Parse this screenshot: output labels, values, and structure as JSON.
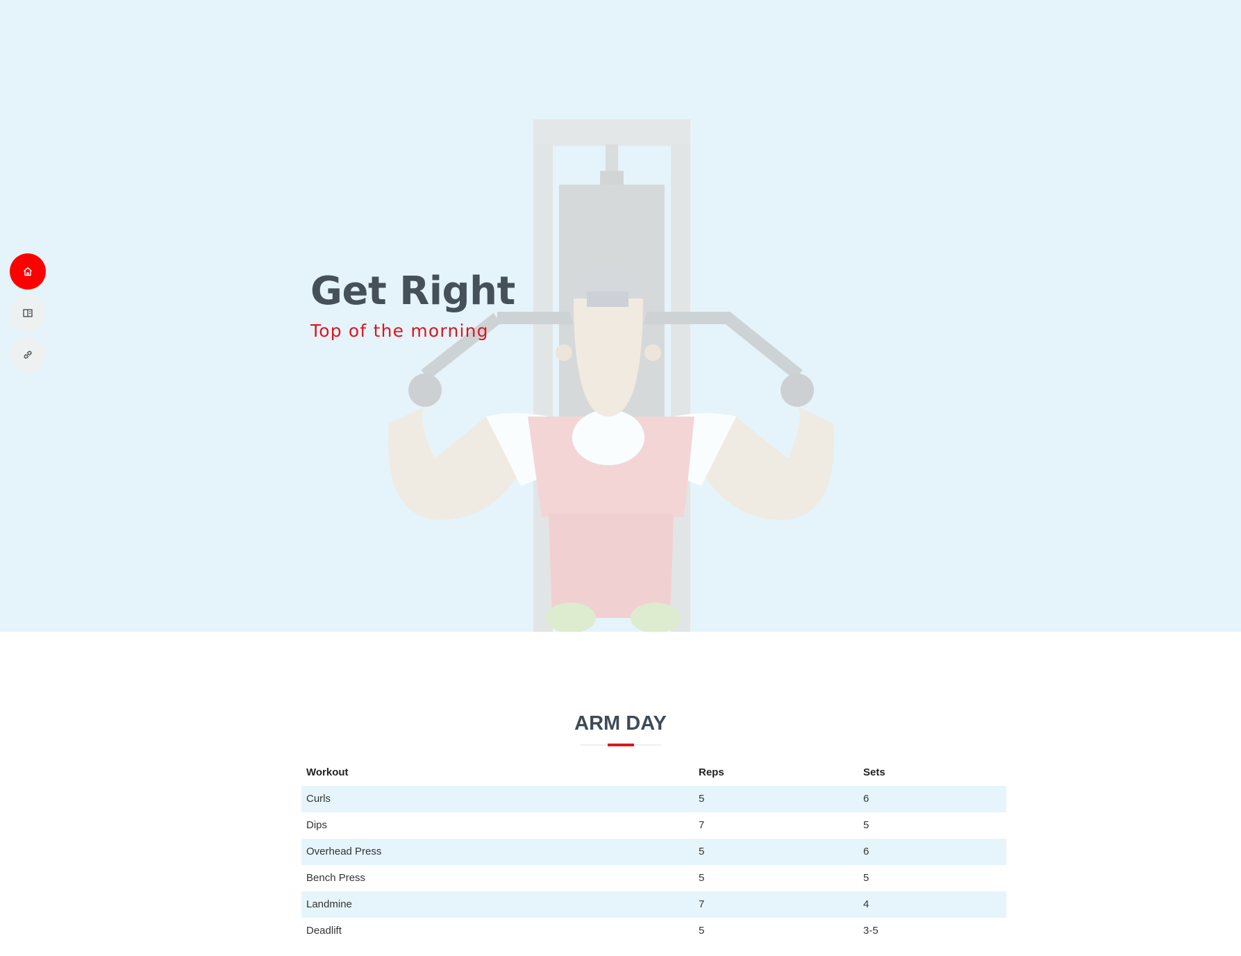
{
  "hero": {
    "title": "Get Right",
    "subtitle": "Top of the morning"
  },
  "nav": [
    {
      "icon": "home-icon",
      "active": true
    },
    {
      "icon": "book-icon",
      "active": false
    },
    {
      "icon": "link-icon",
      "active": false
    }
  ],
  "section": {
    "title": "ARM DAY",
    "columns": [
      "Workout",
      "Reps",
      "Sets"
    ],
    "rows": [
      [
        "Curls",
        "5",
        "6"
      ],
      [
        "Dips",
        "7",
        "5"
      ],
      [
        "Overhead Press",
        "5",
        "6"
      ],
      [
        "Bench Press",
        "5",
        "5"
      ],
      [
        "Landmine",
        "7",
        "4"
      ],
      [
        "Deadlift",
        "5",
        "3-5"
      ]
    ]
  },
  "colors": {
    "accent": "#e0141c",
    "hero_bg": "#e6f4fb",
    "stripe": "#e6f5fc"
  }
}
